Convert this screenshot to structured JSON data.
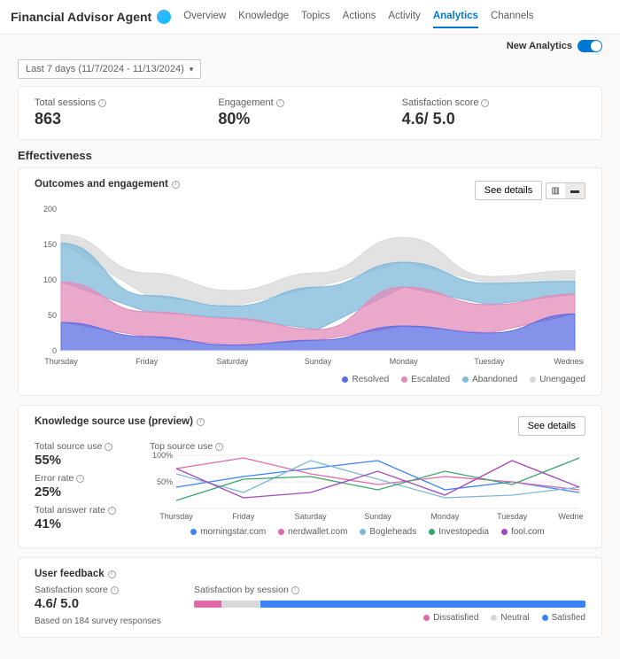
{
  "header": {
    "title": "Financial Advisor Agent",
    "tabs": [
      "Overview",
      "Knowledge",
      "Topics",
      "Actions",
      "Activity",
      "Analytics",
      "Channels"
    ],
    "active_tab": "Analytics"
  },
  "topbar": {
    "new_analytics_label": "New Analytics"
  },
  "daterange": {
    "label": "Last 7 days (11/7/2024 - 11/13/2024)"
  },
  "kpi": {
    "sessions_label": "Total sessions",
    "sessions_value": "863",
    "engagement_label": "Engagement",
    "engagement_value": "80%",
    "satisfaction_label": "Satisfaction score",
    "satisfaction_value": "4.6/ 5.0"
  },
  "effectiveness": {
    "heading": "Effectiveness",
    "card_title": "Outcomes and engagement",
    "see_details": "See details",
    "legend": [
      "Resolved",
      "Escalated",
      "Abandoned",
      "Unengaged"
    ],
    "colors": [
      "#5b6ee1",
      "#e38bb8",
      "#7fb8d9",
      "#d8d8d8"
    ]
  },
  "knowledge": {
    "card_title": "Knowledge source use (preview)",
    "see_details": "See details",
    "metrics": {
      "total_source_label": "Total source use",
      "total_source_value": "55%",
      "error_label": "Error rate",
      "error_value": "25%",
      "answer_label": "Total answer rate",
      "answer_value": "41%"
    },
    "top_label": "Top source use",
    "y_ticks": [
      "100%",
      "50%"
    ],
    "legend": [
      "morningstar.com",
      "nerdwallet.com",
      "Bogleheads",
      "Investopedia",
      "fool.com"
    ],
    "colors": [
      "#3b82f6",
      "#e06aa7",
      "#7fb8d9",
      "#3aa56b",
      "#a347bd"
    ]
  },
  "feedback": {
    "card_title": "User feedback",
    "sat_label": "Satisfaction score",
    "sat_value": "4.6/ 5.0",
    "based": "Based on 184 survey responses",
    "by_session_label": "Satisfaction by session",
    "legend": [
      "Dissatisfied",
      "Neutral",
      "Satisfied"
    ],
    "colors": [
      "#e06aa7",
      "#d8d8d8",
      "#3b82f6"
    ],
    "segments": [
      7,
      10,
      83
    ]
  },
  "categories": [
    "Thursday",
    "Friday",
    "Saturday",
    "Sunday",
    "Monday",
    "Tuesday",
    "Wednesday"
  ],
  "chart_data": [
    {
      "type": "area",
      "title": "Outcomes and engagement",
      "categories": [
        "Thursday",
        "Friday",
        "Saturday",
        "Sunday",
        "Monday",
        "Tuesday",
        "Wednesday"
      ],
      "ylim": [
        0,
        200
      ],
      "y_ticks": [
        0,
        50,
        100,
        150,
        200
      ],
      "series": [
        {
          "name": "Resolved",
          "values": [
            40,
            20,
            8,
            15,
            35,
            25,
            52
          ]
        },
        {
          "name": "Escalated",
          "values": [
            57,
            35,
            38,
            15,
            55,
            40,
            28
          ]
        },
        {
          "name": "Abandoned",
          "values": [
            55,
            23,
            17,
            60,
            35,
            30,
            18
          ]
        },
        {
          "name": "Unengaged",
          "values": [
            12,
            32,
            22,
            20,
            35,
            10,
            15
          ]
        }
      ]
    },
    {
      "type": "line",
      "title": "Top source use",
      "categories": [
        "Thursday",
        "Friday",
        "Saturday",
        "Sunday",
        "Monday",
        "Tuesday",
        "Wednesday"
      ],
      "ylim": [
        0,
        100
      ],
      "series": [
        {
          "name": "morningstar.com",
          "values": [
            40,
            60,
            75,
            90,
            35,
            50,
            30
          ]
        },
        {
          "name": "nerdwallet.com",
          "values": [
            75,
            95,
            65,
            45,
            60,
            50,
            35
          ]
        },
        {
          "name": "Bogleheads",
          "values": [
            65,
            30,
            90,
            55,
            20,
            25,
            40
          ]
        },
        {
          "name": "Investopedia",
          "values": [
            15,
            55,
            60,
            35,
            70,
            45,
            95
          ]
        },
        {
          "name": "fool.com",
          "values": [
            75,
            20,
            30,
            70,
            25,
            90,
            40
          ]
        }
      ]
    },
    {
      "type": "bar",
      "title": "Satisfaction by session",
      "categories": [
        "Dissatisfied",
        "Neutral",
        "Satisfied"
      ],
      "values": [
        7,
        10,
        83
      ]
    }
  ]
}
